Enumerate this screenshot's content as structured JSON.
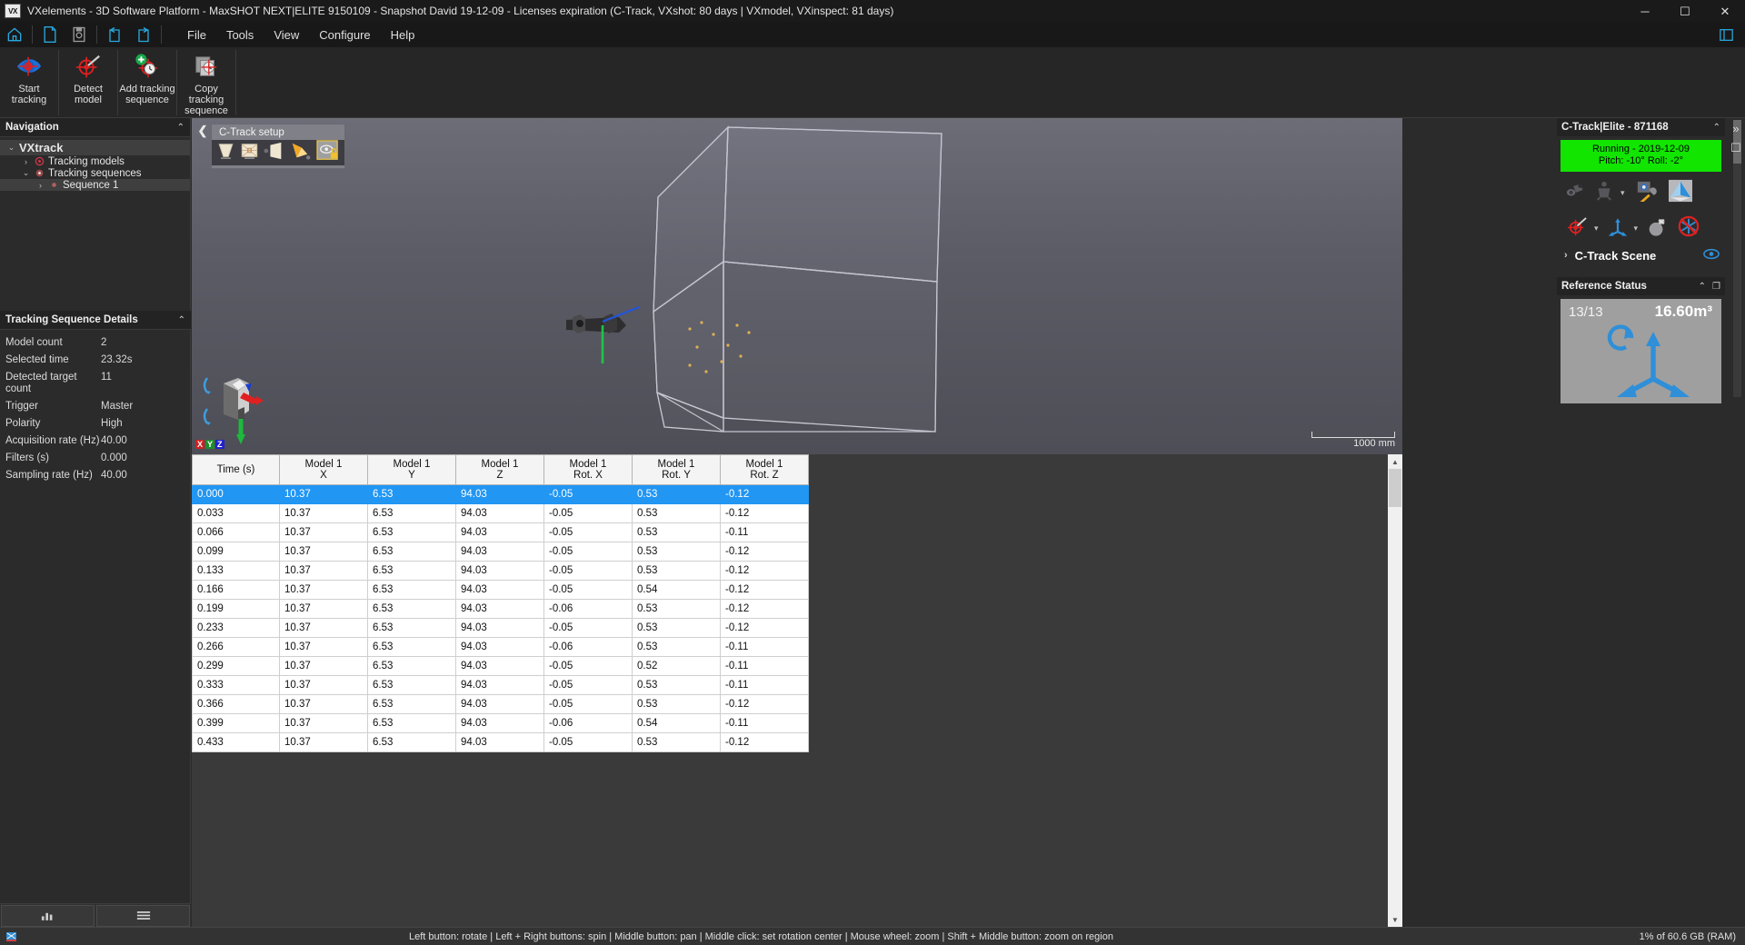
{
  "window": {
    "app_badge": "VX",
    "title": "VXelements - 3D Software Platform - MaxSHOT NEXT|ELITE 9150109 - Snapshot David 19-12-09 - Licenses expiration (C-Track, VXshot: 80 days | VXmodel, VXinspect: 81 days)",
    "minimize": "─",
    "maximize": "☐",
    "close": "✕"
  },
  "menubar": {
    "quick_icons": [
      "home-icon",
      "new-file-icon",
      "save-icon",
      "undo-icon",
      "redo-icon"
    ],
    "items": [
      "File",
      "Tools",
      "View",
      "Configure",
      "Help"
    ],
    "right_icon": "expand-window-icon"
  },
  "ribbon": {
    "buttons": [
      {
        "label_line1": "Start",
        "label_line2": "tracking",
        "icon": "start-tracking-icon"
      },
      {
        "label_line1": "Detect",
        "label_line2": "model",
        "icon": "detect-model-icon"
      },
      {
        "label_line1": "Add tracking",
        "label_line2": "sequence",
        "icon": "add-tracking-sequence-icon"
      },
      {
        "label_line1": "Copy",
        "label_line2": "tracking",
        "label_line3": "sequence",
        "icon": "copy-tracking-sequence-icon"
      }
    ]
  },
  "navigation": {
    "title": "Navigation",
    "collapse_glyph": "⌃",
    "tree": [
      {
        "label": "VXtrack",
        "level": 0,
        "chevron": "⌄",
        "icon": "none",
        "selected": true
      },
      {
        "label": "Tracking models",
        "level": 1,
        "chevron": "›",
        "icon": "target-icon",
        "selected": false
      },
      {
        "label": "Tracking sequences",
        "level": 1,
        "chevron": "⌄",
        "icon": "sequence-icon",
        "selected": false
      },
      {
        "label": "Sequence 1",
        "level": 2,
        "chevron": "›",
        "icon": "dot-icon",
        "selected": true
      }
    ]
  },
  "details": {
    "title": "Tracking Sequence Details",
    "collapse_glyph": "⌃",
    "rows": [
      {
        "key": "Model count",
        "value": "2"
      },
      {
        "key": "Selected time",
        "value": "23.32s"
      },
      {
        "key": "Detected target count",
        "value": "11"
      },
      {
        "key": "Trigger",
        "value": "Master"
      },
      {
        "key": "Polarity",
        "value": "High"
      },
      {
        "key": "Acquisition rate (Hz)",
        "value": "40.00"
      },
      {
        "key": "Filters (s)",
        "value": "0.000"
      },
      {
        "key": "Sampling rate (Hz)",
        "value": "40.00"
      }
    ]
  },
  "sidebar_tabs": [
    {
      "name": "chart-view-tab",
      "icon": "bar-chart-icon"
    },
    {
      "name": "list-view-tab",
      "icon": "list-icon"
    }
  ],
  "viewport": {
    "ctrack_setup": {
      "title": "C-Track setup",
      "collapse_glyph": "❮",
      "icons": [
        "volume-frustum-icon",
        "calibration-target-icon",
        "camera-cone-icon",
        "projector-icon",
        "visibility-lock-icon"
      ]
    },
    "gizmo": {
      "axis_letters": [
        "X",
        "Y",
        "Z"
      ]
    },
    "scalebar": {
      "label": "1000 mm"
    }
  },
  "table": {
    "columns": [
      {
        "line1": "Time (s)",
        "line2": ""
      },
      {
        "line1": "Model 1",
        "line2": "X"
      },
      {
        "line1": "Model 1",
        "line2": "Y"
      },
      {
        "line1": "Model 1",
        "line2": "Z"
      },
      {
        "line1": "Model 1",
        "line2": "Rot. X"
      },
      {
        "line1": "Model 1",
        "line2": "Rot. Y"
      },
      {
        "line1": "Model 1",
        "line2": "Rot. Z"
      }
    ],
    "rows": [
      {
        "cells": [
          "0.000",
          "10.37",
          "6.53",
          "94.03",
          "-0.05",
          "0.53",
          "-0.12"
        ],
        "selected": true
      },
      {
        "cells": [
          "0.033",
          "10.37",
          "6.53",
          "94.03",
          "-0.05",
          "0.53",
          "-0.12"
        ],
        "selected": false
      },
      {
        "cells": [
          "0.066",
          "10.37",
          "6.53",
          "94.03",
          "-0.05",
          "0.53",
          "-0.11"
        ],
        "selected": false
      },
      {
        "cells": [
          "0.099",
          "10.37",
          "6.53",
          "94.03",
          "-0.05",
          "0.53",
          "-0.12"
        ],
        "selected": false
      },
      {
        "cells": [
          "0.133",
          "10.37",
          "6.53",
          "94.03",
          "-0.05",
          "0.53",
          "-0.12"
        ],
        "selected": false
      },
      {
        "cells": [
          "0.166",
          "10.37",
          "6.53",
          "94.03",
          "-0.05",
          "0.54",
          "-0.12"
        ],
        "selected": false
      },
      {
        "cells": [
          "0.199",
          "10.37",
          "6.53",
          "94.03",
          "-0.06",
          "0.53",
          "-0.12"
        ],
        "selected": false
      },
      {
        "cells": [
          "0.233",
          "10.37",
          "6.53",
          "94.03",
          "-0.05",
          "0.53",
          "-0.12"
        ],
        "selected": false
      },
      {
        "cells": [
          "0.266",
          "10.37",
          "6.53",
          "94.03",
          "-0.06",
          "0.53",
          "-0.11"
        ],
        "selected": false
      },
      {
        "cells": [
          "0.299",
          "10.37",
          "6.53",
          "94.03",
          "-0.05",
          "0.52",
          "-0.11"
        ],
        "selected": false
      },
      {
        "cells": [
          "0.333",
          "10.37",
          "6.53",
          "94.03",
          "-0.05",
          "0.53",
          "-0.11"
        ],
        "selected": false
      },
      {
        "cells": [
          "0.366",
          "10.37",
          "6.53",
          "94.03",
          "-0.05",
          "0.53",
          "-0.12"
        ],
        "selected": false
      },
      {
        "cells": [
          "0.399",
          "10.37",
          "6.53",
          "94.03",
          "-0.06",
          "0.54",
          "-0.11"
        ],
        "selected": false
      },
      {
        "cells": [
          "0.433",
          "10.37",
          "6.53",
          "94.03",
          "-0.05",
          "0.53",
          "-0.12"
        ],
        "selected": false
      }
    ]
  },
  "right_panel": {
    "device": {
      "title": "C-Track|Elite - 871168",
      "collapse_glyph": "⌃",
      "status_line1": "Running - 2019-12-09",
      "status_line2": "Pitch: -10° Roll: -2°",
      "status_color": "#11e500",
      "icon_row_1": [
        "camera-pair-icon",
        "targets-icon",
        "dropdown-caret-icon",
        "camera-settings-icon",
        "volume-icon"
      ],
      "icon_row_2": [
        "target-calib-icon",
        "dropdown-caret-icon",
        "axis-icon",
        "dropdown-caret-icon",
        "bomb-remove-icon",
        "no-targets-icon"
      ],
      "scene_label": "C-Track Scene",
      "scene_chevron": "›",
      "scene_eye": "visibility-eye-icon"
    },
    "reference_status": {
      "title": "Reference Status",
      "collapse_glyph": "⌃",
      "undock_glyph": "❐",
      "count": "13/13",
      "volume": "16.60m³",
      "icon": "rotation-axes-icon"
    },
    "side_buttons": [
      "expand-panel-icon",
      "restore-panel-icon"
    ]
  },
  "statusbar": {
    "hints": "Left button: rotate  |  Left + Right buttons: spin  |  Middle button: pan  |  Middle click: set rotation center  |  Mouse wheel: zoom  |  Shift + Middle button: zoom on region",
    "ram": "1% of 60.6 GB (RAM)"
  }
}
